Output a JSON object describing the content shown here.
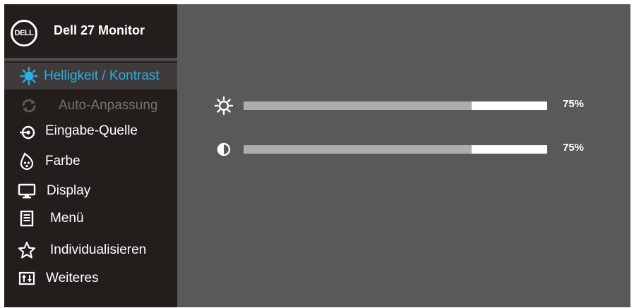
{
  "header": {
    "logo_text": "DELL",
    "title": "Dell 27 Monitor"
  },
  "menu": {
    "items": [
      {
        "label": "Helligkeit / Kontrast",
        "icon": "brightness-icon",
        "state": "active"
      },
      {
        "label": "Auto-Anpassung",
        "icon": "auto-adjust-icon",
        "state": "disabled"
      },
      {
        "label": "Eingabe-Quelle",
        "icon": "input-source-icon",
        "state": "normal"
      },
      {
        "label": "Farbe",
        "icon": "color-icon",
        "state": "normal"
      },
      {
        "label": "Display",
        "icon": "display-icon",
        "state": "normal"
      },
      {
        "label": "Menü",
        "icon": "menu-icon",
        "state": "normal"
      },
      {
        "label": "Individualisieren",
        "icon": "star-icon",
        "state": "normal"
      },
      {
        "label": "Weiteres",
        "icon": "others-icon",
        "state": "normal"
      }
    ]
  },
  "sliders": {
    "brightness": {
      "icon": "sun-icon",
      "value_text": "75%",
      "value": 0.75
    },
    "contrast": {
      "icon": "contrast-icon",
      "value_text": "75%",
      "value": 0.75
    }
  },
  "colors": {
    "sidebar_bg": "#231e1c",
    "content_bg": "#595959",
    "active_item_bg": "#3f3b3a",
    "accent": "#2aaee4",
    "slider_fill": "#adadad",
    "slider_track": "#ffffff",
    "disabled_text": "#77716f"
  }
}
